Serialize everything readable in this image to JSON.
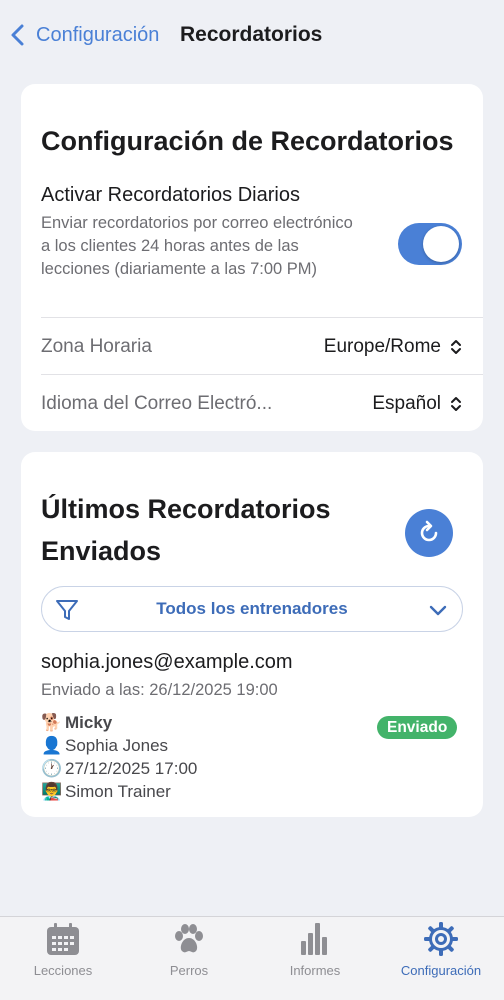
{
  "nav": {
    "back_label": "Configuración",
    "title": "Recordatorios"
  },
  "settings": {
    "title": "Configuración de Recordatorios",
    "daily_toggle": {
      "label": "Activar Recordatorios Diarios",
      "description": "Enviar recordatorios por correo electrónico a los clientes 24 horas antes de las lecciones (diariamente a las 7:00 PM)",
      "enabled": true
    },
    "timezone": {
      "label": "Zona Horaria",
      "value": "Europe/Rome"
    },
    "email_language": {
      "label": "Idioma del Correo Electró...",
      "value": "Español"
    }
  },
  "recent": {
    "title": "Últimos Recordatorios Enviados",
    "filter": {
      "value": "Todos los entrenadores"
    },
    "items": [
      {
        "email": "sophia.jones@example.com",
        "sent_at": "Enviado a las: 26/12/2025 19:00",
        "dog_emoji": "🐕",
        "dog": "Micky",
        "client_emoji": "👤",
        "client": "Sophia Jones",
        "time_emoji": "🕐",
        "lesson_time": "27/12/2025 17:00",
        "trainer_emoji": "👨‍🏫",
        "trainer": "Simon Trainer",
        "status": "Enviado"
      }
    ]
  },
  "tabs": [
    {
      "label": "Lecciones",
      "icon": "calendar-icon",
      "active": false
    },
    {
      "label": "Perros",
      "icon": "paw-icon",
      "active": false
    },
    {
      "label": "Informes",
      "icon": "bar-chart-icon",
      "active": false
    },
    {
      "label": "Configuración",
      "icon": "gear-icon",
      "active": true
    }
  ],
  "colors": {
    "accent": "#4a80d6",
    "success": "#43b36a",
    "background": "#eef0f5"
  }
}
